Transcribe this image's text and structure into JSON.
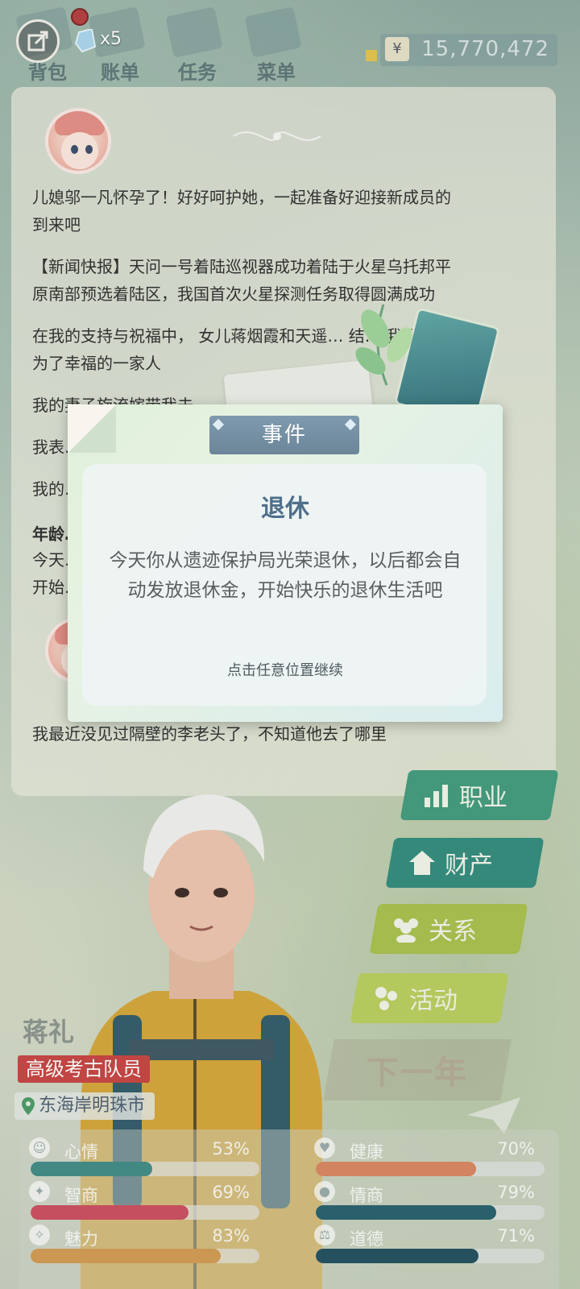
{
  "topbar": {
    "tabs": [
      {
        "label": "背包"
      },
      {
        "label": "账单"
      },
      {
        "label": "任务"
      },
      {
        "label": "菜单"
      }
    ],
    "gem_count": "x5",
    "currency_symbol": "¥",
    "money": "15,770,472"
  },
  "log": {
    "lines": [
      "儿媳邬一凡怀孕了！好好呵护她，一起准备好迎接新成员的",
      "到来吧",
      "【新闻快报】天问一号着陆巡视器成功着陆于火星乌托邦平",
      "原南部预选着陆区，我国首次火星探测任务取得圆满成功",
      "在我的支持与祝福中， 女儿蒋烟霞和天遥… 结… 我们成",
      "为了幸福的一家人",
      "我的妻子旋流嫁带我去…",
      "我表…",
      "我的…",
      "年龄…",
      "今天…",
      "开始…",
      "我最近没见过隔壁的李老头了，不知道他去了哪里"
    ]
  },
  "event": {
    "tab_label": "事件",
    "heading": "退休",
    "body": "今天你从遗迹保护局光荣退休，以后都会自动发放退休金，开始快乐的退休生活吧",
    "hint": "点击任意位置继续"
  },
  "actions": {
    "career": "职业",
    "assets": "财产",
    "relations": "关系",
    "activities": "活动",
    "next_year": "下一年"
  },
  "character": {
    "name": "蒋礼",
    "job": "高级考古队员",
    "city": "东海岸明珠市"
  },
  "stats": [
    {
      "label": "心情",
      "value": "53%",
      "fraction": 0.53,
      "color": "#3e8a86",
      "icon": "smile-icon"
    },
    {
      "label": "健康",
      "value": "70%",
      "fraction": 0.7,
      "color": "#d9855e",
      "icon": "heart-icon"
    },
    {
      "label": "智商",
      "value": "69%",
      "fraction": 0.69,
      "color": "#cc4a5e",
      "icon": "bulb-icon"
    },
    {
      "label": "情商",
      "value": "79%",
      "fraction": 0.79,
      "color": "#235e6c",
      "icon": "apple-icon"
    },
    {
      "label": "魅力",
      "value": "83%",
      "fraction": 0.83,
      "color": "#d39a50",
      "icon": "sparkle-icon"
    },
    {
      "label": "道德",
      "value": "71%",
      "fraction": 0.71,
      "color": "#1f4d5c",
      "icon": "scale-icon"
    }
  ]
}
